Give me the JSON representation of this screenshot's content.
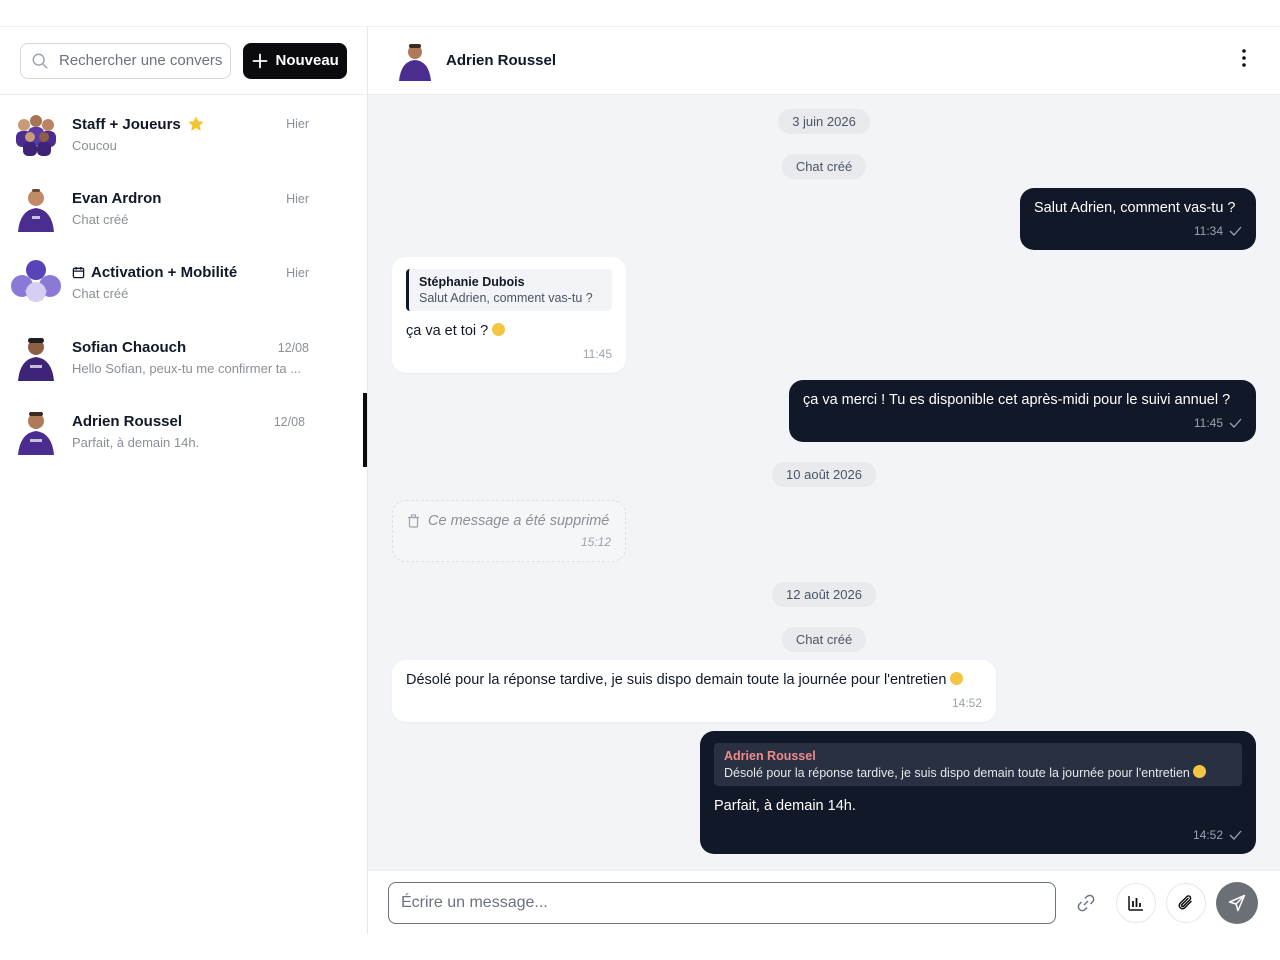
{
  "sidebar": {
    "search_placeholder": "Rechercher une convers",
    "new_button": "Nouveau",
    "conversations": [
      {
        "name": "Staff + Joueurs",
        "preview": "Coucou",
        "time": "Hier",
        "icon": "star-icon"
      },
      {
        "name": "Evan Ardron",
        "preview": "Chat créé",
        "time": "Hier"
      },
      {
        "name": "Activation + Mobilité",
        "preview": "Chat créé",
        "time": "Hier",
        "icon": "calendar-icon"
      },
      {
        "name": "Sofian Chaouch",
        "preview": "Hello Sofian, peux-tu me confirmer ta ...",
        "time": "12/08"
      },
      {
        "name": "Adrien Roussel",
        "preview": "Parfait, à demain 14h.",
        "time": "12/08",
        "active": true
      }
    ]
  },
  "chat": {
    "header_name": "Adrien Roussel",
    "dates": [
      "3 juin 2026",
      "10 août 2026",
      "12 août 2026"
    ],
    "system": [
      "Chat créé",
      "Chat créé"
    ],
    "messages": {
      "m1": {
        "text": "Salut Adrien, comment vas-tu ?",
        "time": "11:34"
      },
      "m2": {
        "quote_name": "Stéphanie Dubois",
        "quote_text": "Salut Adrien, comment vas-tu ?",
        "text": "ça va et toi ?",
        "time": "11:45"
      },
      "m3": {
        "text": "ça va merci ! Tu es disponible cet après-midi pour le suivi annuel ?",
        "time": "11:45"
      },
      "m4": {
        "text": "Ce message a été supprimé",
        "time": "15:12"
      },
      "m5": {
        "text": "Désolé pour la réponse tardive, je suis dispo demain toute la journée pour l'entretien",
        "time": "14:52"
      },
      "m6": {
        "quote_name": "Adrien Roussel",
        "quote_text": "Désolé pour la réponse tardive, je suis dispo demain toute la journée pour l'entretien",
        "text": "Parfait, à demain 14h.",
        "time": "14:52"
      }
    },
    "composer_placeholder": "Écrire un message..."
  },
  "colors": {
    "accent": "#0b0b0f",
    "bubble_out": "#111827",
    "quote_name_out": "#f08a8a",
    "brand_purple": "#5b3aa6"
  }
}
